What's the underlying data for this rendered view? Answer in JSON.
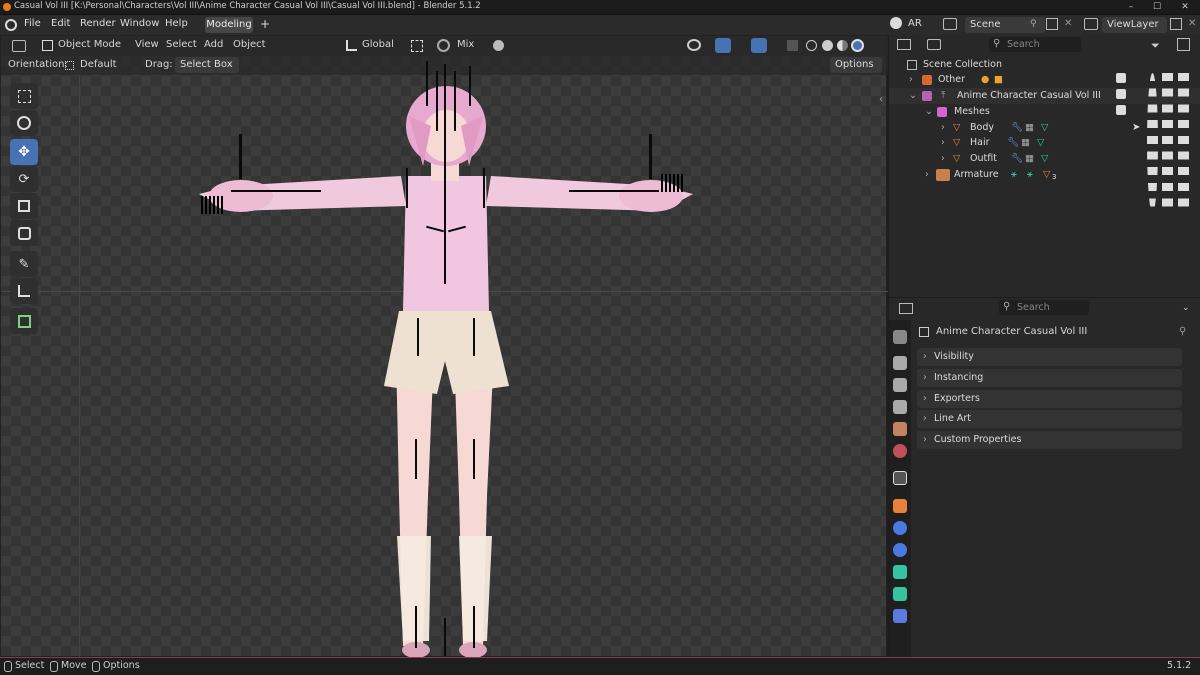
{
  "window": {
    "title": "Casual Vol III [K:\\Personal\\Characters\\Vol III\\Anime Character Casual Vol III\\Casual Vol III.blend] - Blender 5.1.2",
    "minimize": "–",
    "maximize": "☐",
    "close": "✕"
  },
  "menu": {
    "file": "File",
    "edit": "Edit",
    "render": "Render",
    "window": "Window",
    "help": "Help",
    "tab": "Modeling",
    "add_tab": "+"
  },
  "topright": {
    "workspace_code": "AR",
    "scene": "Scene",
    "view_layer": "ViewLayer"
  },
  "viewport": {
    "mode": "Object Mode",
    "view": "View",
    "select": "Select",
    "add": "Add",
    "object": "Object",
    "transform": "Global",
    "snap": "Mix",
    "orientation_label": "Orientation:",
    "orientation_value": "Default",
    "drag_label": "Drag:",
    "drag_value": "Select Box",
    "options": "Options"
  },
  "outliner": {
    "search": "Search",
    "scene_collection": "Scene Collection",
    "items": [
      {
        "label": "Other"
      },
      {
        "label": "Anime Character Casual Vol III"
      },
      {
        "label": "Meshes"
      },
      {
        "label": "Body"
      },
      {
        "label": "Hair"
      },
      {
        "label": "Outfit"
      },
      {
        "label": "Armature"
      }
    ],
    "armature_count": "3"
  },
  "properties": {
    "search": "Search",
    "object_name": "Anime Character Casual Vol III",
    "sections": [
      "Visibility",
      "Instancing",
      "Exporters",
      "Line Art",
      "Custom Properties"
    ]
  },
  "status": {
    "select": "Select",
    "move": "Move",
    "options": "Options",
    "version": "5.1.2"
  },
  "colors": {
    "accent": "#4772b3",
    "shirt": "#f0c6e0",
    "hair": "#e7a9cf",
    "skin": "#f6d8d4",
    "shorts": "#efe1d1"
  }
}
